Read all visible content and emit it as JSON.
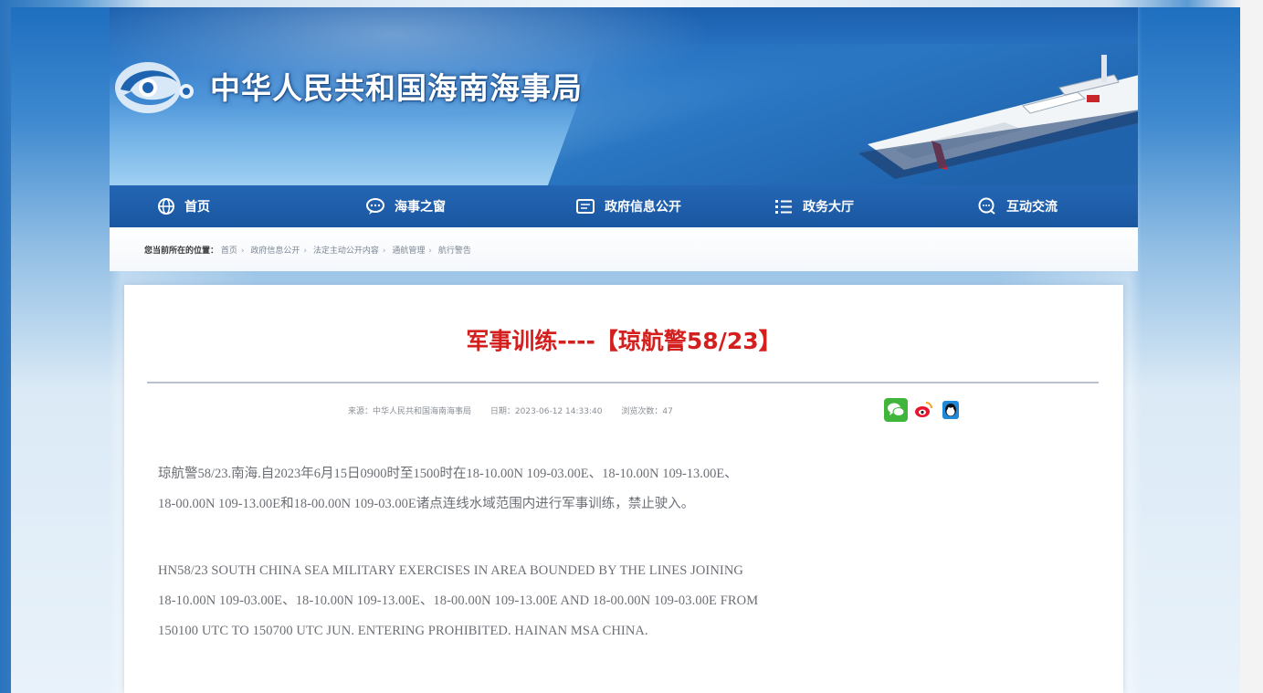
{
  "header": {
    "site_title": "中华人民共和国海南海事局"
  },
  "nav": {
    "items": [
      {
        "label": "首页",
        "icon": "globe-icon"
      },
      {
        "label": "海事之窗",
        "icon": "chat-icon"
      },
      {
        "label": "政府信息公开",
        "icon": "document-icon"
      },
      {
        "label": "政务大厅",
        "icon": "list-icon"
      },
      {
        "label": "互动交流",
        "icon": "message-icon"
      }
    ]
  },
  "breadcrumb": {
    "lead": "您当前所在的位置：",
    "items": [
      "首页",
      "政府信息公开",
      "法定主动公开内容",
      "通航管理",
      "航行警告"
    ]
  },
  "article": {
    "title": "军事训练----【琼航警58/23】",
    "meta": {
      "source": "来源：中华人民共和国海南海事局",
      "date": "日期：2023-06-12 14:33:40",
      "views": "浏览次数：47"
    },
    "share_icons": [
      "wechat-icon",
      "weibo-icon",
      "qq-icon"
    ],
    "para_cn_line1": "琼航警58/23.南海.自2023年6月15日0900时至1500时在18-10.00N 109-03.00E、18-10.00N 109-13.00E、",
    "para_cn_line2": "18-00.00N 109-13.00E和18-00.00N 109-03.00E诸点连线水域范围内进行军事训练，禁止驶入。",
    "para_en_line1": "HN58/23 SOUTH CHINA SEA MILITARY EXERCISES IN AREA BOUNDED BY THE LINES JOINING",
    "para_en_line2": "18-10.00N 109-03.00E、18-10.00N 109-13.00E、18-00.00N 109-13.00E AND 18-00.00N 109-03.00E FROM",
    "para_en_line3": "150100 UTC TO 150700 UTC JUN. ENTERING PROHIBITED. HAINAN MSA CHINA."
  }
}
